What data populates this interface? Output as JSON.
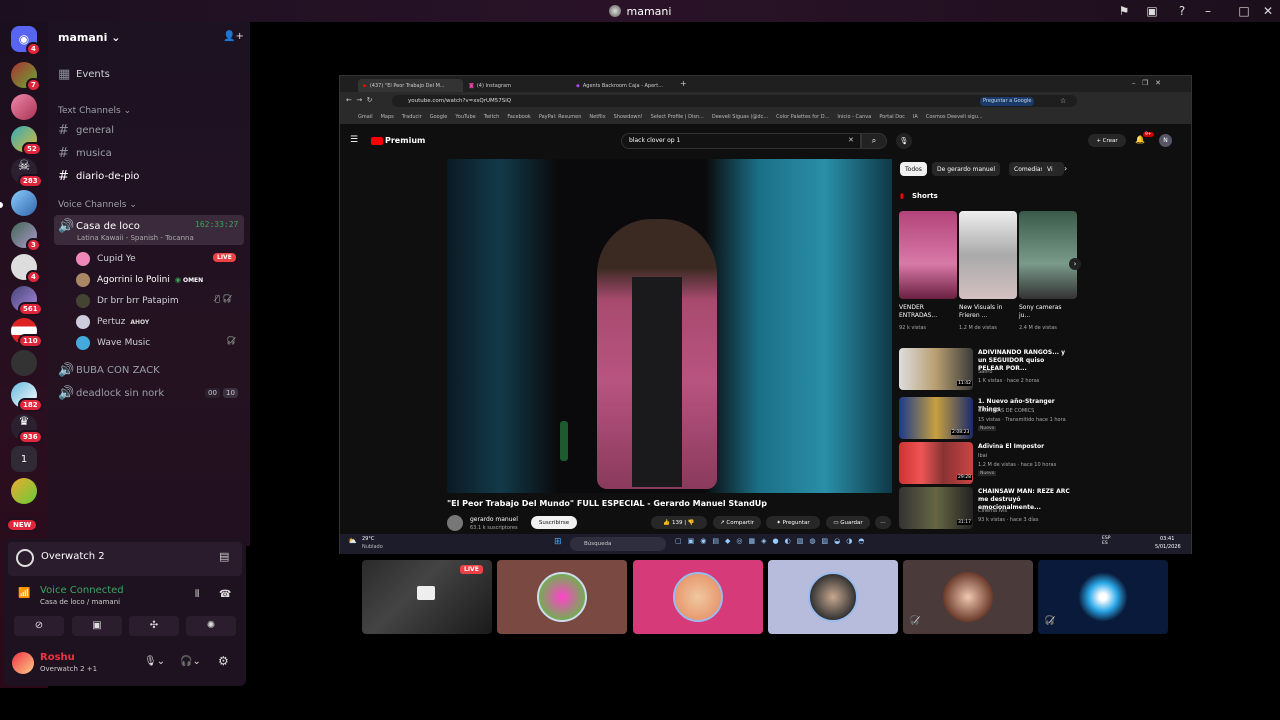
{
  "window": {
    "title": "mamani"
  },
  "server": {
    "name": "mamani",
    "events": "Events",
    "text_category": "Text Channels",
    "voice_category": "Voice Channels"
  },
  "text_channels": [
    "general",
    "musica",
    "diario-de-pio"
  ],
  "voice": {
    "active": "Casa de loco",
    "active_timer": "162:33:27",
    "active_status": "Latina Kawaii - Spanish - Tocanna",
    "users": [
      {
        "name": "Cupid Ye",
        "tag": "LIVE"
      },
      {
        "name": "Agorrini lo Polini",
        "tag": "OMEN"
      },
      {
        "name": "Dr brr brr Patapim",
        "tag": ""
      },
      {
        "name": "Pertuz",
        "tag": "AHOY"
      },
      {
        "name": "Wave Music",
        "tag": ""
      }
    ],
    "other1": "BUBA CON ZACK",
    "other2": "deadlock sin nork",
    "count_a": "00",
    "count_b": "10"
  },
  "rail_badges": [
    "4",
    "7",
    "52",
    "283",
    "3",
    "4",
    "561",
    "110",
    "182",
    "936",
    "1",
    "NEW"
  ],
  "panel": {
    "game": "Overwatch 2",
    "status": "Voice Connected",
    "location": "Casa de loco / mamani",
    "username": "Roshu",
    "activity": "Overwatch 2 +1"
  },
  "stream": {
    "live": "LIVE"
  },
  "browser": {
    "tabs": [
      "(437) \"El Peor Trabajo Del M...",
      "(4) Instagram",
      "Agents Backroom Caja - Apert..."
    ],
    "url": "youtube.com/watch?v=xsQrUM57SiQ",
    "ask_google": "Preguntar a Google",
    "bookmarks": [
      "Gmail",
      "Maps",
      "Traducir",
      "Google",
      "YouTube",
      "Twitch",
      "Facebook",
      "PayPal: Resumen",
      "Netflix",
      "Showdown!",
      "Select Profile | Disn...",
      "Deeveli Siguas (@dc...",
      "Color Palettes for D...",
      "Inicio - Canva",
      "Portal Doc",
      "IA",
      "Cosmos Deeveli sigu..."
    ]
  },
  "youtube": {
    "logo": "Premium",
    "search": "black clover op 1",
    "create": "+ Crear",
    "notif": "9+",
    "chips": [
      "Todos",
      "De gerardo manuel",
      "Comedias",
      "Vi"
    ],
    "video_title": "\"El Peor Trabajo Del Mundo\" FULL ESPECIAL - Gerardo Manuel StandUp",
    "channel": "gerardo manuel",
    "subs": "63.1 k suscriptores",
    "subscribe": "Suscribirse",
    "likes": "139",
    "share": "Compartir",
    "ask": "Preguntar",
    "save": "Guardar",
    "shorts_label": "Shorts",
    "shorts": [
      {
        "title": "VENDER ENTRADAS...",
        "views": "92 k vistas"
      },
      {
        "title": "New Visuals in Frieren ...",
        "views": "1.2 M de vistas"
      },
      {
        "title": "Sony cameras ju...",
        "views": "2.4 M de vistas"
      }
    ],
    "recs": [
      {
        "title": "ADIVINANDO RANGOS... y un SEGUIDOR quiso PELEAR POR...",
        "channel": "Safiro",
        "meta": "1 K vistas · hace 2 horas",
        "dur": "11:42"
      },
      {
        "title": "1. Nuevo año-Stranger Things",
        "channel": "CRONICAS DE COMICS",
        "meta": "15 vistas · Transmitido hace 1 hora",
        "dur": "2:08:23"
      },
      {
        "title": "Adivina El Impostor",
        "channel": "Ibai",
        "meta": "1.2 M de vistas · hace 10 horas",
        "dur": "29:28"
      },
      {
        "title": "CHAINSAW MAN: REZE ARC me destruyó emocionalmente...",
        "channel": "Cinema Ivis",
        "meta": "93 k vistas · hace 3 días",
        "dur": "31:17"
      }
    ],
    "new": "Nuevo"
  },
  "taskbar": {
    "weather": "29°C",
    "weather2": "Nublado",
    "search": "Búsqueda",
    "lang": "ESP ES",
    "time": "03:41",
    "date": "5/01/2026"
  },
  "colors": {
    "accent": "#5865f2",
    "live": "#ed4245",
    "yt_red": "#ff0000"
  }
}
